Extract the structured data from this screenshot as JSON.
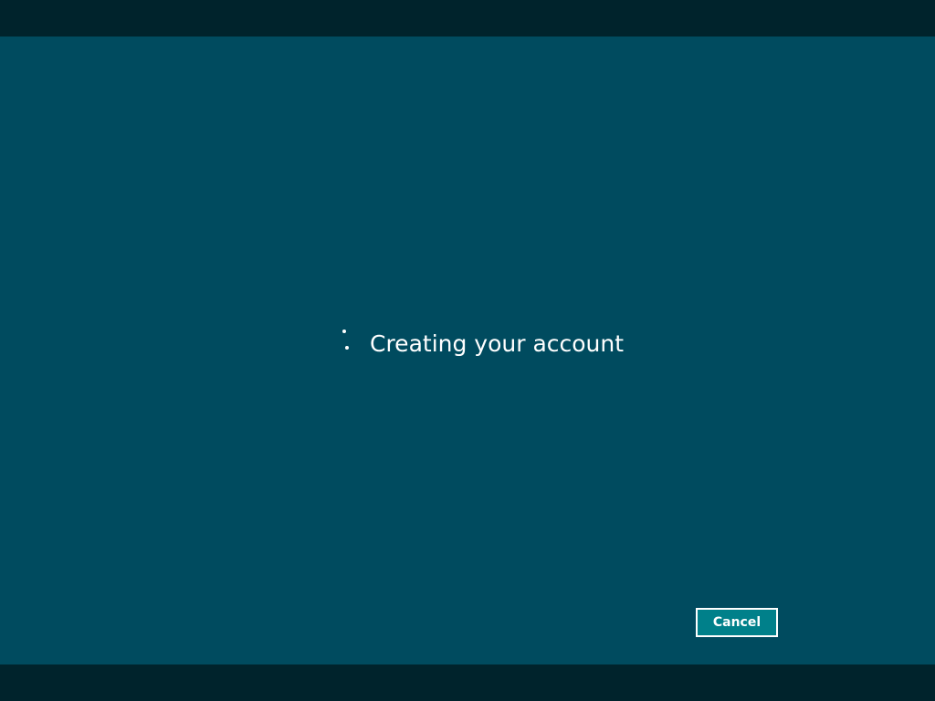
{
  "colors": {
    "frame": "#00232c",
    "panel": "#004b5f",
    "button_fill": "#00808a",
    "text": "#ffffff"
  },
  "status": {
    "spinner_icon": "progress-dots-icon",
    "message": "Creating your account"
  },
  "actions": {
    "cancel_label": "Cancel"
  }
}
